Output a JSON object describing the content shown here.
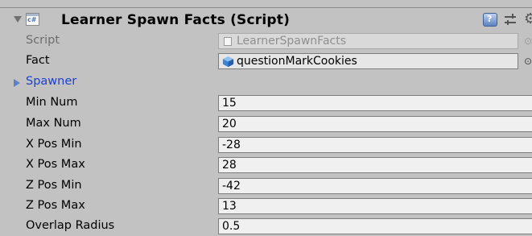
{
  "component": {
    "title": "Learner Spawn Facts (Script)",
    "icon": "csharp-script-icon",
    "icon_text": "c#"
  },
  "fields": {
    "script": {
      "label": "Script",
      "value": "LearnerSpawnFacts"
    },
    "fact": {
      "label": "Fact",
      "value": "questionMarkCookies"
    },
    "spawner": {
      "label": "Spawner"
    },
    "min_num": {
      "label": "Min Num",
      "value": "15"
    },
    "max_num": {
      "label": "Max Num",
      "value": "20"
    },
    "x_pos_min": {
      "label": "X Pos Min",
      "value": "-28"
    },
    "x_pos_max": {
      "label": "X Pos Max",
      "value": "28"
    },
    "z_pos_min": {
      "label": "Z Pos Min",
      "value": "-42"
    },
    "z_pos_max": {
      "label": "Z Pos Max",
      "value": "13"
    },
    "overlap_radius": {
      "label": "Overlap Radius",
      "value": "0.5"
    }
  },
  "colors": {
    "background": "#c2c2c2",
    "link_label": "#1e3fd0",
    "field_bg": "#f0f0f0"
  }
}
